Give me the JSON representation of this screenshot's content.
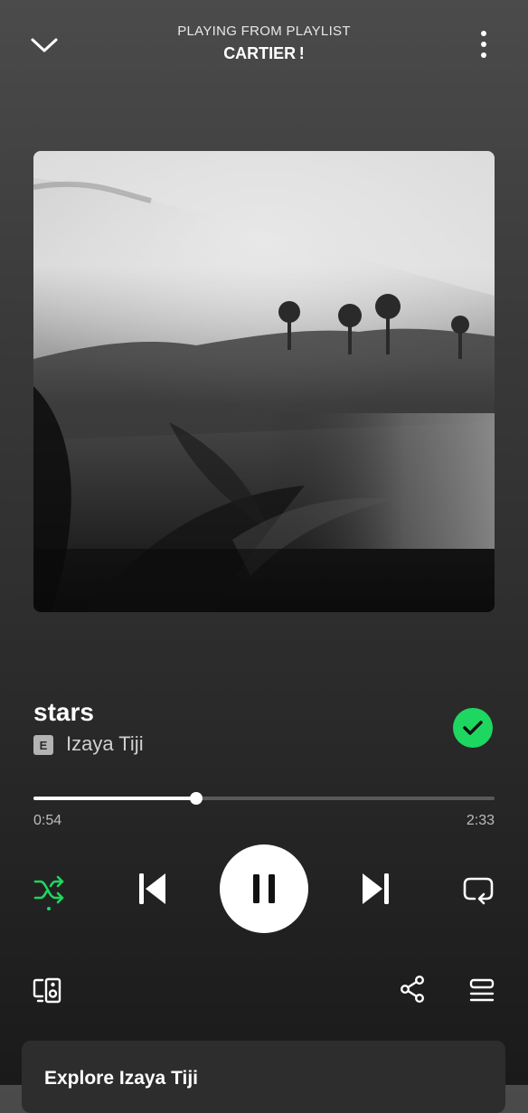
{
  "header": {
    "context_label": "PLAYING FROM PLAYLIST",
    "playlist_name": "CARTIER !",
    "collapse_icon": "chevron-down-icon",
    "more_icon": "more-vertical-icon"
  },
  "album_art": {
    "description_icon": "album-art"
  },
  "track": {
    "title": "stars",
    "explicit_badge": "E",
    "artist": "Izaya Tiji",
    "liked": true
  },
  "playback": {
    "elapsed": "0:54",
    "duration": "2:33",
    "progress_fraction": 0.353,
    "is_playing": true,
    "shuffle_on": true
  },
  "controls": {
    "shuffle_icon": "shuffle-icon",
    "previous_icon": "skip-previous-icon",
    "pause_icon": "pause-icon",
    "next_icon": "skip-next-icon",
    "repeat_icon": "repeat-icon",
    "devices_icon": "connect-devices-icon",
    "share_icon": "share-icon",
    "queue_icon": "queue-icon"
  },
  "explore": {
    "title": "Explore Izaya Tiji"
  },
  "colors": {
    "accent": "#1ed760",
    "background_top": "#4b4b4b",
    "background_bottom": "#1a1a1a"
  }
}
